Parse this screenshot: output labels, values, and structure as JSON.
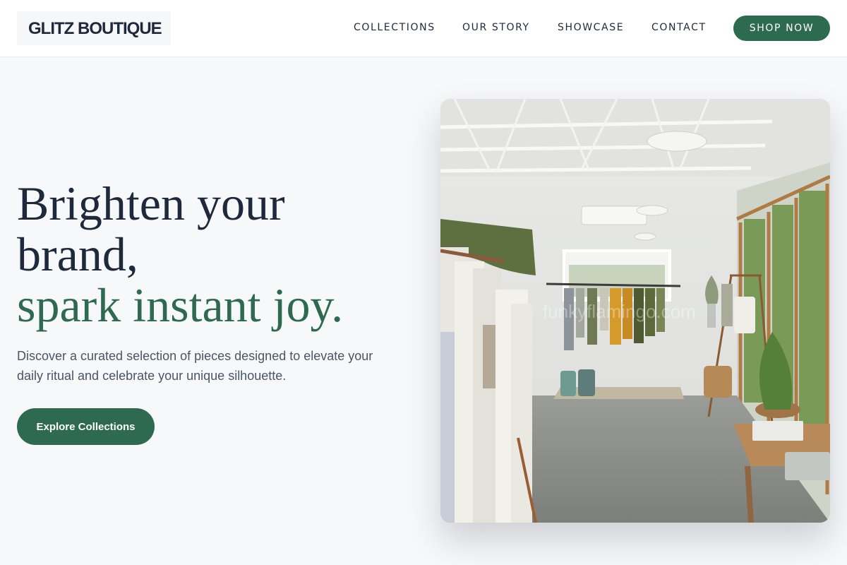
{
  "brand": {
    "name": "GLITZ BOUTIQUE",
    "accent_color": "#2d6a4f",
    "text_color": "#1e293b"
  },
  "nav": {
    "items": [
      {
        "label": "COLLECTIONS"
      },
      {
        "label": "OUR STORY"
      },
      {
        "label": "SHOWCASE"
      },
      {
        "label": "CONTACT"
      }
    ],
    "cta_label": "SHOP NOW"
  },
  "hero": {
    "headline_line1": "Brighten your",
    "headline_line2": "brand,",
    "headline_accent": "spark instant joy.",
    "subtext": "Discover a curated selection of pieces designed to elevate your daily ritual and celebrate your unique silhouette.",
    "cta_label": "Explore Collections",
    "image_subject": "boutique interior with clothing racks",
    "watermark": "funkyflamingo.com"
  }
}
